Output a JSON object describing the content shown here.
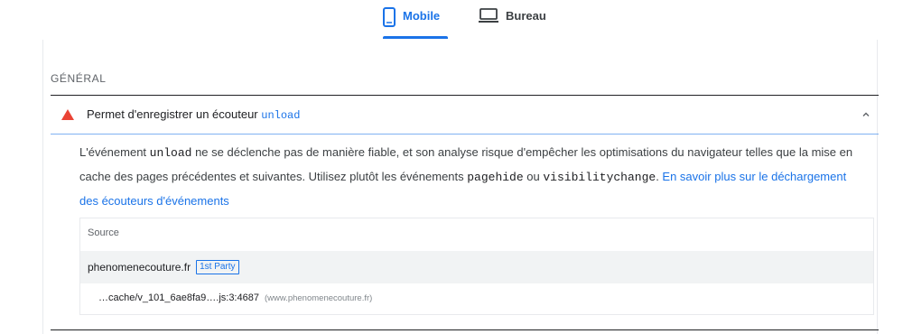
{
  "tabs": [
    {
      "label": "Mobile",
      "icon": "mobile-phone-icon",
      "active": true
    },
    {
      "label": "Bureau",
      "icon": "desktop-icon",
      "active": false
    }
  ],
  "section": {
    "title": "GÉNÉRAL"
  },
  "audit": {
    "status_icon": "warning-triangle-icon",
    "status_color": "#ea4335",
    "title_prefix": "Permet d'enregistrer un écouteur ",
    "title_code": "unload",
    "description": {
      "part1": "L'événement ",
      "code1": "unload",
      "part2": " ne se déclenche pas de manière fiable, et son analyse risque d'empêcher les optimisations du navigateur telles que la mise en cache des pages précédentes et suivantes. Utilisez plutôt les événements ",
      "code2": "pagehide",
      "part3": " ou ",
      "code3": "visibilitychange",
      "part4": ". ",
      "link": "En savoir plus sur le déchargement des écouteurs d'événements"
    },
    "table": {
      "header": "Source",
      "rows": [
        {
          "url": "phenomenecouture.fr",
          "badge": "1st Party"
        }
      ],
      "subrows": [
        {
          "location": "…cache/v_101_6ae8fa9….js:3:4687",
          "origin": "(www.phenomenecouture.fr)"
        }
      ]
    }
  },
  "colors": {
    "accent": "#1a73e8",
    "warning": "#ea4335"
  }
}
